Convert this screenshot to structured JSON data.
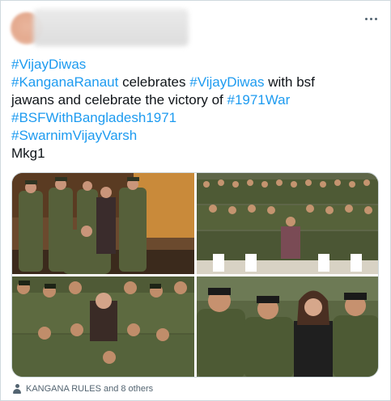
{
  "tweet": {
    "text_lines": [
      [
        {
          "t": "#VijayDiwas",
          "tag": true
        }
      ],
      [
        {
          "t": "#KanganaRanaut",
          "tag": true
        },
        {
          "t": " celebrates ",
          "tag": false
        },
        {
          "t": "#VijayDiwas",
          "tag": true
        },
        {
          "t": " with bsf",
          "tag": false
        }
      ],
      [
        {
          "t": "jawans and celebrate the victory of ",
          "tag": false
        },
        {
          "t": "#1971War",
          "tag": true
        }
      ],
      [
        {
          "t": "#BSFWithBangladesh1971",
          "tag": true
        }
      ],
      [
        {
          "t": " #SwarnimVijayVarsh",
          "tag": true
        }
      ],
      [
        {
          "t": "Mkg1",
          "tag": false
        }
      ]
    ]
  },
  "media": {
    "photos": [
      {
        "alt": "Kangana Ranaut standing with BSF jawans in uniform on a stage"
      },
      {
        "alt": "Kangana Ranaut seated among a large group of BSF jawans"
      },
      {
        "alt": "Kangana Ranaut posing with a group of BSF jawans"
      },
      {
        "alt": "Close-up of Kangana Ranaut smiling with BSF jawans"
      }
    ]
  },
  "footer": {
    "tagged_text": "KANGANA RULES and 8 others",
    "icon": "person-icon"
  },
  "colors": {
    "hashtag": "#1d9bf0",
    "text": "#0f1419",
    "muted": "#536471",
    "border": "#cfd9de"
  }
}
